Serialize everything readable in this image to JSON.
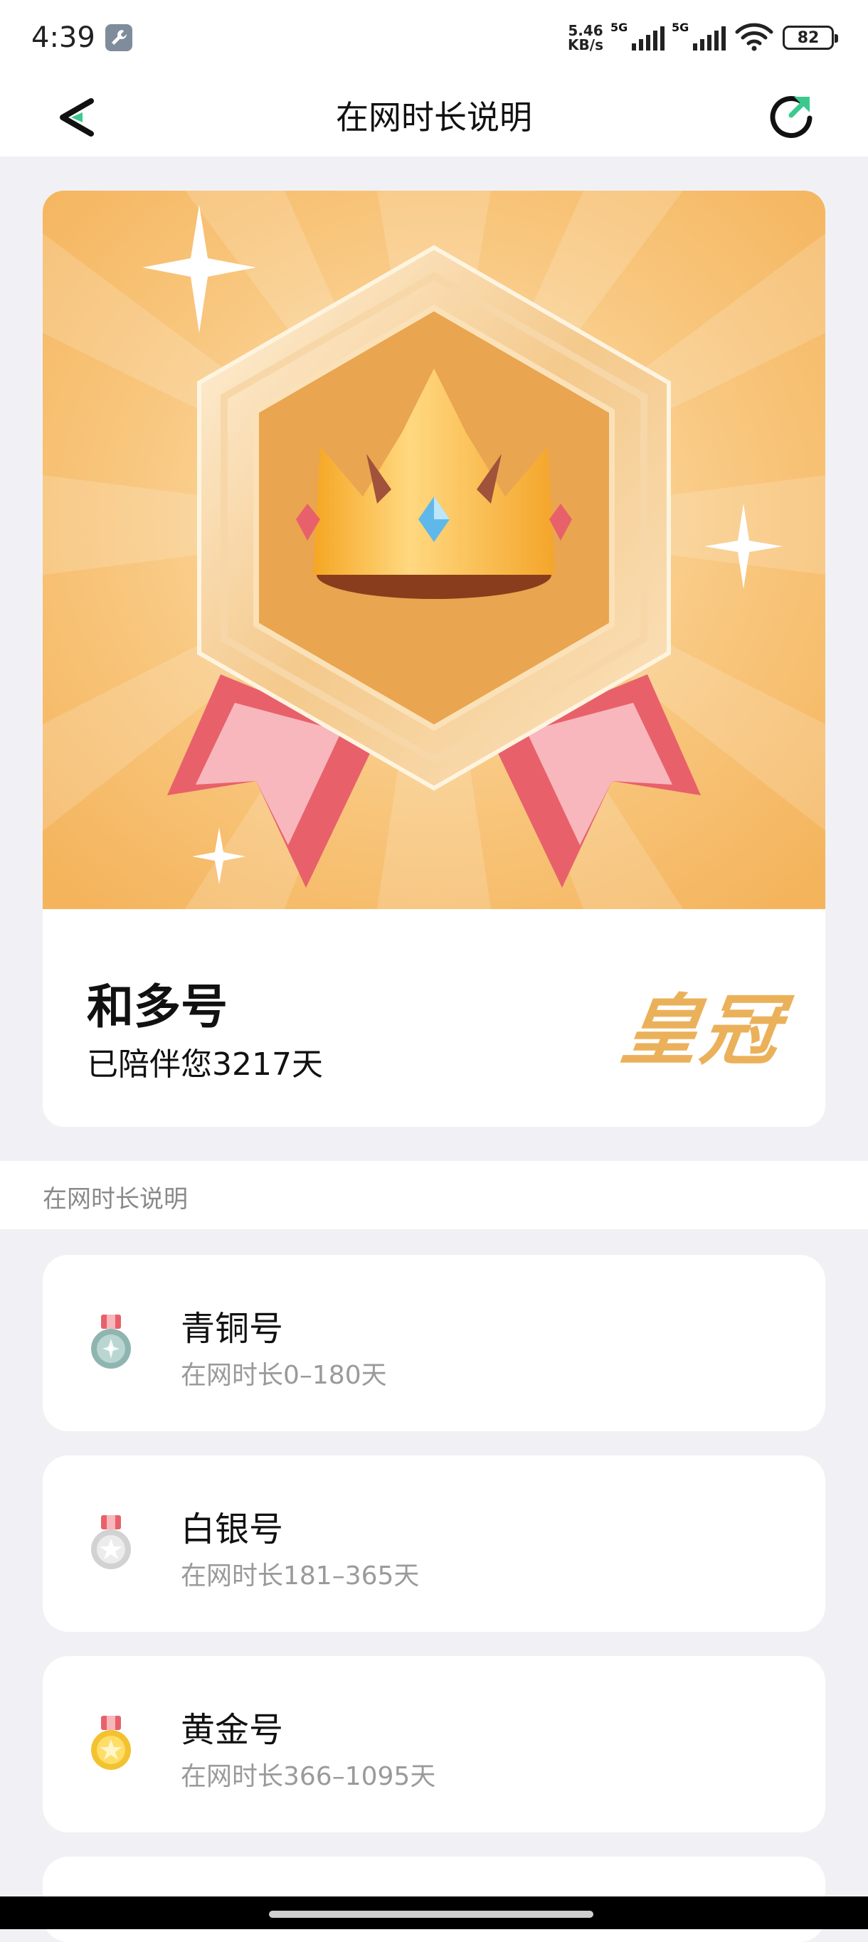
{
  "status_bar": {
    "time": "4:39",
    "net_speed_value": "5.46",
    "net_speed_unit": "KB/s",
    "sim1_gen": "5G",
    "sim2_gen": "5G",
    "battery": "82",
    "tool_icon": "wrench-icon",
    "wifi_icon": "wifi-icon"
  },
  "nav": {
    "title": "在网时长说明",
    "back_icon": "back-arrow-icon",
    "share_icon": "refresh-share-icon",
    "accent": "#3cc98f"
  },
  "hero": {
    "badge_image": "crown-medal",
    "level_name": "和多号",
    "days_text": "已陪伴您3217天",
    "badge_text": "皇冠",
    "badge_color": "#ebb15a",
    "background_color": "#f5b860"
  },
  "section": {
    "title": "在网时长说明"
  },
  "tiers": [
    {
      "name": "青铜号",
      "range": "在网时长0–180天",
      "medal_icon": "bronze-medal-icon",
      "color": "#8fb5b0"
    },
    {
      "name": "白银号",
      "range": "在网时长181–365天",
      "medal_icon": "silver-medal-icon",
      "color": "#d2d2d2"
    },
    {
      "name": "黄金号",
      "range": "在网时长366–1095天",
      "medal_icon": "gold-medal-icon",
      "color": "#f2c230"
    }
  ]
}
